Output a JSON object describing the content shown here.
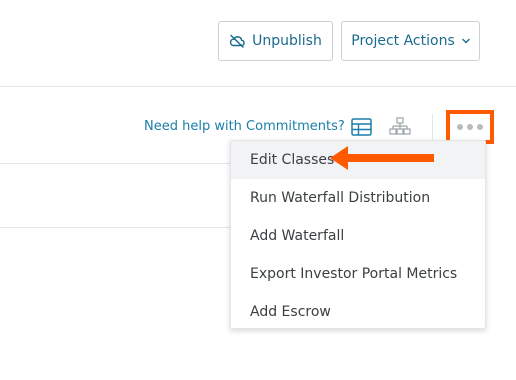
{
  "header": {
    "unpublish_label": "Unpublish",
    "project_actions_label": "Project Actions",
    "cloud_icon": "cloud-off-icon",
    "chevron_icon": "chevron-down-icon"
  },
  "toolbar": {
    "help_link": "Need help with Commitments?",
    "table_icon": "table-view-icon",
    "tree_icon": "tree-view-icon",
    "more_icon": "more-options-icon"
  },
  "menu": {
    "items": [
      {
        "label": "Edit Classes"
      },
      {
        "label": "Run Waterfall Distribution"
      },
      {
        "label": "Add Waterfall"
      },
      {
        "label": "Export Investor Portal Metrics"
      },
      {
        "label": "Add Escrow"
      }
    ]
  },
  "colors": {
    "accent": "#1a6a8d",
    "link": "#1a7fa8",
    "highlight": "#ff5a00",
    "border": "#c9d1d6"
  }
}
